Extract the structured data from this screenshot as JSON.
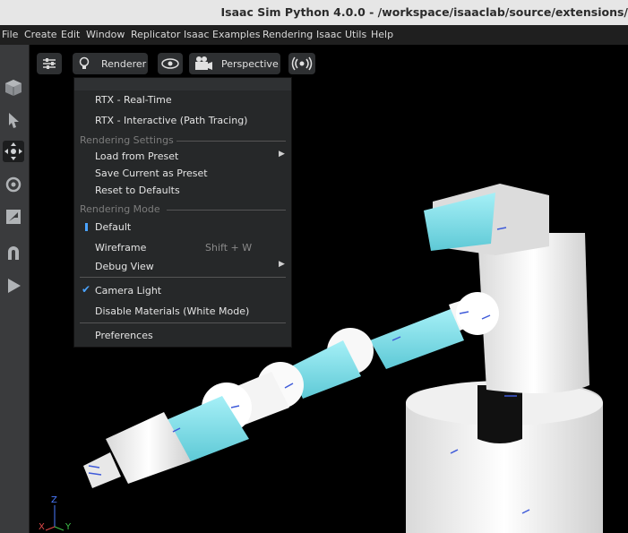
{
  "window": {
    "title": "Isaac Sim Python 4.0.0 - /workspace/isaaclab/source/extensions/"
  },
  "menubar": {
    "items": [
      "File",
      "Create",
      "Edit",
      "Window",
      "Replicator",
      "Isaac Examples",
      "Rendering",
      "Isaac Utils",
      "Help"
    ]
  },
  "toolbar": {
    "tools": [
      "cube-icon",
      "select-arrow-icon",
      "move-icon",
      "rotate-icon",
      "scale-icon",
      "snap-magnet-icon",
      "play-icon"
    ],
    "active_tool": "move-icon"
  },
  "viewport_toolbar": {
    "renderer_label": "Renderer",
    "camera_label": "Perspective"
  },
  "renderer_menu": {
    "modes": [
      "RTX - Real-Time",
      "RTX - Interactive (Path Tracing)"
    ],
    "rendering_settings_header": "Rendering Settings",
    "settings_items": [
      "Load from Preset",
      "Save Current as Preset",
      "Reset to Defaults"
    ],
    "rendering_mode_header": "Rendering Mode",
    "mode_default": "Default",
    "mode_wireframe": "Wireframe",
    "wireframe_shortcut": "Shift + W",
    "debug_view": "Debug View",
    "camera_light": "Camera Light",
    "disable_materials": "Disable Materials (White Mode)",
    "preferences": "Preferences"
  },
  "axis_gizmo": {
    "x": "X",
    "y": "Y",
    "z": "Z"
  },
  "colors": {
    "accent": "#4aa3ff",
    "robot_link": "#79dde8",
    "robot_body": "#f2f2f2",
    "menu_bg": "#262829"
  }
}
